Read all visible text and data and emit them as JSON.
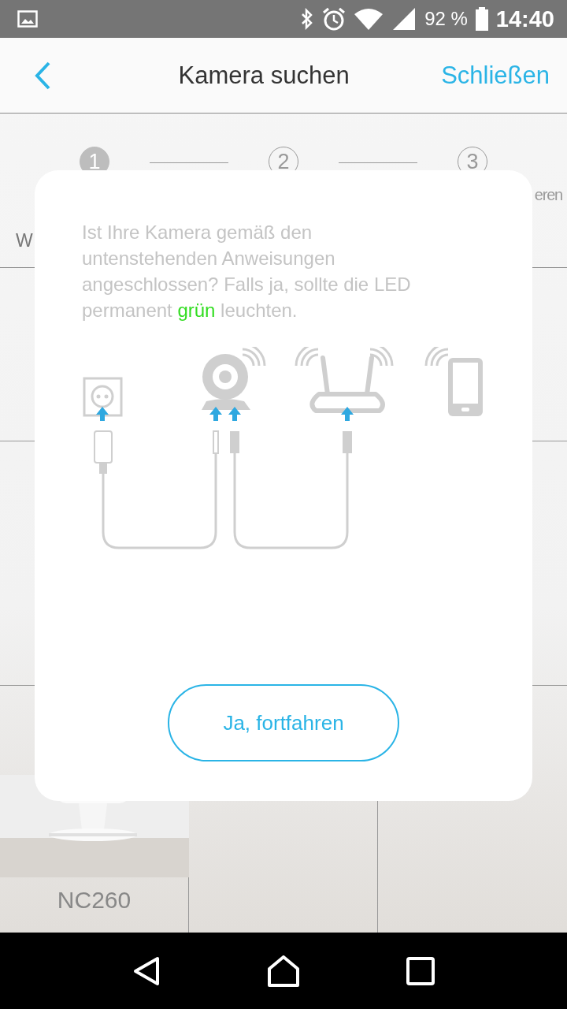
{
  "status_bar": {
    "battery": "92 %",
    "time": "14:40"
  },
  "header": {
    "title": "Kamera suchen",
    "close": "Schließen"
  },
  "stepper": {
    "steps": [
      {
        "number": "1",
        "selected": true
      },
      {
        "number": "2",
        "selected": false
      },
      {
        "number": "3",
        "label": "eren",
        "selected": false
      }
    ]
  },
  "subtitle": "W",
  "grid": {
    "cells": [
      {
        "kind": "empty"
      },
      {
        "kind": "empty"
      },
      {
        "kind": "empty"
      },
      {
        "kind": "empty"
      },
      {
        "kind": "empty"
      },
      {
        "kind": "empty"
      },
      {
        "kind": "camera",
        "label": "NC260"
      },
      {
        "kind": "empty"
      },
      {
        "kind": "empty"
      }
    ]
  },
  "dialog": {
    "message": [
      [
        {
          "text": "Ist Ihre Kamera gemäß den",
          "highlight": false
        }
      ],
      [
        {
          "text": "untenstehenden Anweisungen",
          "highlight": false
        }
      ],
      [
        {
          "text": "angeschlossen? Falls ja, sollte die LED",
          "highlight": false
        }
      ],
      [
        {
          "text": "permanent ",
          "highlight": false
        },
        {
          "text": "grün",
          "highlight": true
        },
        {
          "text": " leuchten.",
          "highlight": false
        }
      ]
    ],
    "button": "Ja, fortfahren"
  }
}
